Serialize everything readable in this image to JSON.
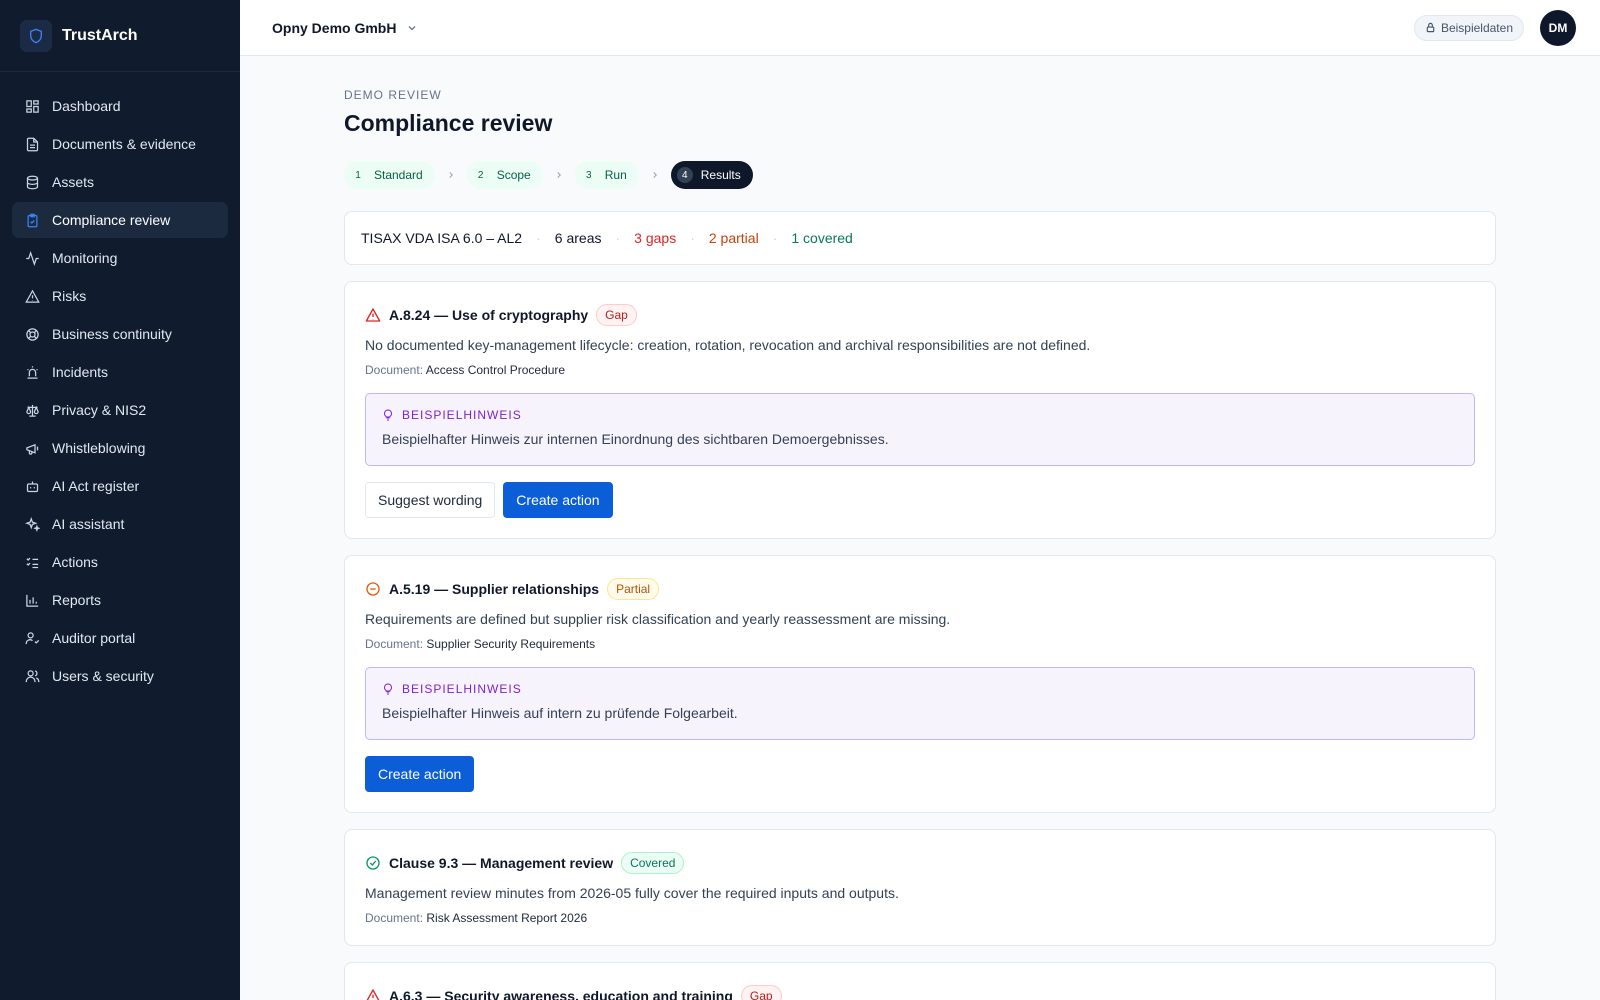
{
  "app": {
    "name": "TrustArch"
  },
  "sidebar": {
    "items": [
      {
        "label": "Dashboard",
        "icon": "dashboard-icon",
        "active": false
      },
      {
        "label": "Documents & evidence",
        "icon": "document-icon",
        "active": false
      },
      {
        "label": "Assets",
        "icon": "database-icon",
        "active": false
      },
      {
        "label": "Compliance review",
        "icon": "clipboard-check-icon",
        "active": true
      },
      {
        "label": "Monitoring",
        "icon": "activity-icon",
        "active": false
      },
      {
        "label": "Risks",
        "icon": "warning-triangle-icon",
        "active": false
      },
      {
        "label": "Business continuity",
        "icon": "lifebuoy-icon",
        "active": false
      },
      {
        "label": "Incidents",
        "icon": "siren-icon",
        "active": false
      },
      {
        "label": "Privacy & NIS2",
        "icon": "scale-icon",
        "active": false
      },
      {
        "label": "Whistleblowing",
        "icon": "megaphone-icon",
        "active": false
      },
      {
        "label": "AI Act register",
        "icon": "bot-icon",
        "active": false
      },
      {
        "label": "AI assistant",
        "icon": "sparkles-icon",
        "active": false
      },
      {
        "label": "Actions",
        "icon": "list-checks-icon",
        "active": false
      },
      {
        "label": "Reports",
        "icon": "bar-chart-icon",
        "active": false
      },
      {
        "label": "Auditor portal",
        "icon": "user-check-icon",
        "active": false
      },
      {
        "label": "Users & security",
        "icon": "users-icon",
        "active": false
      }
    ]
  },
  "topbar": {
    "tenant": "Opny Demo GmbH",
    "demo_badge": "Beispieldaten",
    "avatar_initials": "DM"
  },
  "page": {
    "eyebrow": "DEMO REVIEW",
    "title": "Compliance review"
  },
  "stepper": [
    {
      "num": "1",
      "label": "Standard"
    },
    {
      "num": "2",
      "label": "Scope"
    },
    {
      "num": "3",
      "label": "Run"
    },
    {
      "num": "4",
      "label": "Results"
    }
  ],
  "summary": {
    "standard": "TISAX VDA ISA 6.0 – AL2",
    "areas": "6 areas",
    "gaps": "3 gaps",
    "partial": "2 partial",
    "covered": "1 covered"
  },
  "findings": [
    {
      "title": "A.8.24 — Use of cryptography",
      "status": "Gap",
      "description": "No documented key-management lifecycle: creation, rotation, revocation and archival responsibilities are not defined.",
      "doc_label": "Document:",
      "doc": "Access Control Procedure",
      "hint_label": "BEISPIELHINWEIS",
      "hint": "Beispielhafter Hinweis zur internen Einordnung des sichtbaren Demoergebnisses.",
      "secondary_button": "Suggest wording",
      "primary_button": "Create action"
    },
    {
      "title": "A.5.19 — Supplier relationships",
      "status": "Partial",
      "description": "Requirements are defined but supplier risk classification and yearly reassessment are missing.",
      "doc_label": "Document:",
      "doc": "Supplier Security Requirements",
      "hint_label": "BEISPIELHINWEIS",
      "hint": "Beispielhafter Hinweis auf intern zu prüfende Folgearbeit.",
      "primary_button": "Create action"
    },
    {
      "title": "Clause 9.3 — Management review",
      "status": "Covered",
      "description": "Management review minutes from 2026-05 fully cover the required inputs and outputs.",
      "doc_label": "Document:",
      "doc": "Risk Assessment Report 2026"
    },
    {
      "title": "A.6.3 — Security awareness, education and training",
      "status": "Gap"
    }
  ],
  "colors": {
    "sidebar_bg": "#101b2d",
    "primary": "#0b5ed7",
    "gap": "#dc2626",
    "partial": "#c2410c",
    "covered": "#047857",
    "hint_accent": "#7e22ce"
  }
}
